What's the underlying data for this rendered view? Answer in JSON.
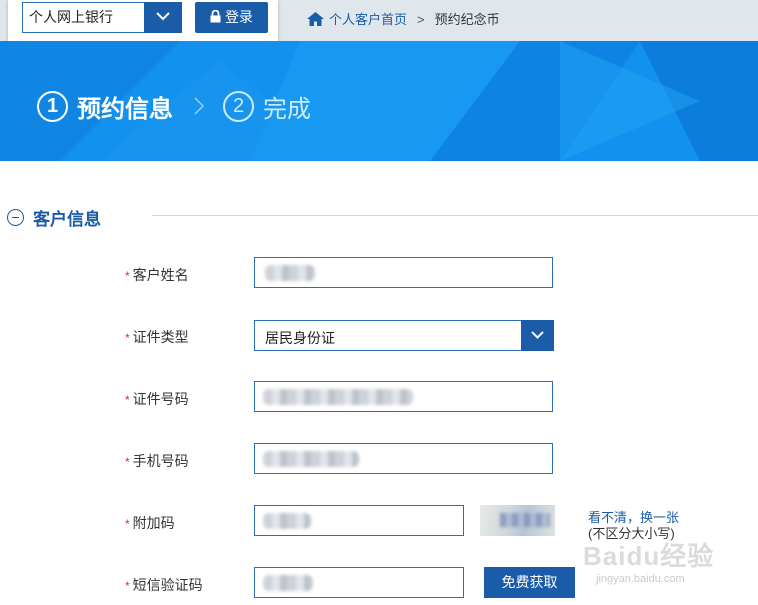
{
  "topbar": {
    "bank_select": {
      "value": "个人网上银行",
      "icon": "chevron-down-icon"
    },
    "login_label": "登录",
    "breadcrumb": {
      "home": "个人客户首页",
      "separator": ">",
      "current": "预约纪念币"
    }
  },
  "banner": {
    "steps": [
      {
        "num": "1",
        "label": "预约信息",
        "active": true
      },
      {
        "num": "2",
        "label": "完成",
        "active": false
      }
    ],
    "color": "#1391ee"
  },
  "section": {
    "title": "客户信息"
  },
  "form": {
    "required_mark": "*",
    "name": {
      "label": "客户姓名",
      "value": ""
    },
    "id_type": {
      "label": "证件类型",
      "value": "居民身份证"
    },
    "id_number": {
      "label": "证件号码",
      "value": ""
    },
    "phone": {
      "label": "手机号码",
      "value": ""
    },
    "captcha": {
      "label": "附加码",
      "value": "",
      "refresh": "看不清，换一张",
      "hint": "(不区分大小写)"
    },
    "sms": {
      "label": "短信验证码",
      "value": "",
      "button": "免费获取"
    }
  },
  "watermark": {
    "text": "Baidu经验",
    "sub": "jingyan.baidu.com"
  },
  "colors": {
    "accent": "#1a5ca8",
    "required": "#ee2233"
  }
}
